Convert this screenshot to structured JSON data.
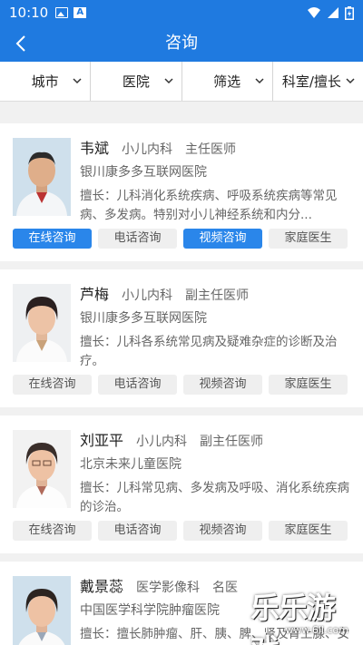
{
  "status": {
    "time": "10:10"
  },
  "header": {
    "title": "咨询"
  },
  "filters": [
    {
      "label": "城市"
    },
    {
      "label": "医院"
    },
    {
      "label": "筛选"
    },
    {
      "label": "科室/擅长"
    }
  ],
  "doctors": [
    {
      "name": "韦斌",
      "department": "小儿内科",
      "title": "主任医师",
      "hospital": "银川康多多互联网医院",
      "specialty": "擅长：儿科消化系统疾病、呼吸系统疾病等常见病、多发病。特别对小儿神经系统和内分...",
      "buttons": [
        {
          "label": "在线咨询",
          "active": true
        },
        {
          "label": "电话咨询",
          "active": false
        },
        {
          "label": "视频咨询",
          "active": true
        },
        {
          "label": "家庭医生",
          "active": false
        }
      ]
    },
    {
      "name": "芦梅",
      "department": "小儿内科",
      "title": "副主任医师",
      "hospital": "银川康多多互联网医院",
      "specialty": "擅长：儿科各系统常见病及疑难杂症的诊断及治疗。",
      "buttons": [
        {
          "label": "在线咨询",
          "active": false
        },
        {
          "label": "电话咨询",
          "active": false
        },
        {
          "label": "视频咨询",
          "active": false
        },
        {
          "label": "家庭医生",
          "active": false
        }
      ]
    },
    {
      "name": "刘亚平",
      "department": "小儿内科",
      "title": "副主任医师",
      "hospital": "北京未来儿童医院",
      "specialty": "擅长：儿科常见病、多发病及呼吸、消化系统疾病的诊治。",
      "buttons": [
        {
          "label": "在线咨询",
          "active": false
        },
        {
          "label": "电话咨询",
          "active": false
        },
        {
          "label": "视频咨询",
          "active": false
        },
        {
          "label": "家庭医生",
          "active": false
        }
      ]
    },
    {
      "name": "戴景蕊",
      "department": "医学影像科",
      "title": "名医",
      "hospital": "中国医学科学院肿瘤医院",
      "specialty": "擅长：擅长肺肿瘤、肝、胰、脾、肾及肾上腺、女性生殖系肿瘤、腹部肿块、盆腔肿块等",
      "buttons": []
    }
  ],
  "watermark": {
    "text": "乐乐游戏",
    "url": "www.6ll.com"
  },
  "colors": {
    "primary": "#1f7ae0",
    "button_active": "#2a86ea"
  }
}
